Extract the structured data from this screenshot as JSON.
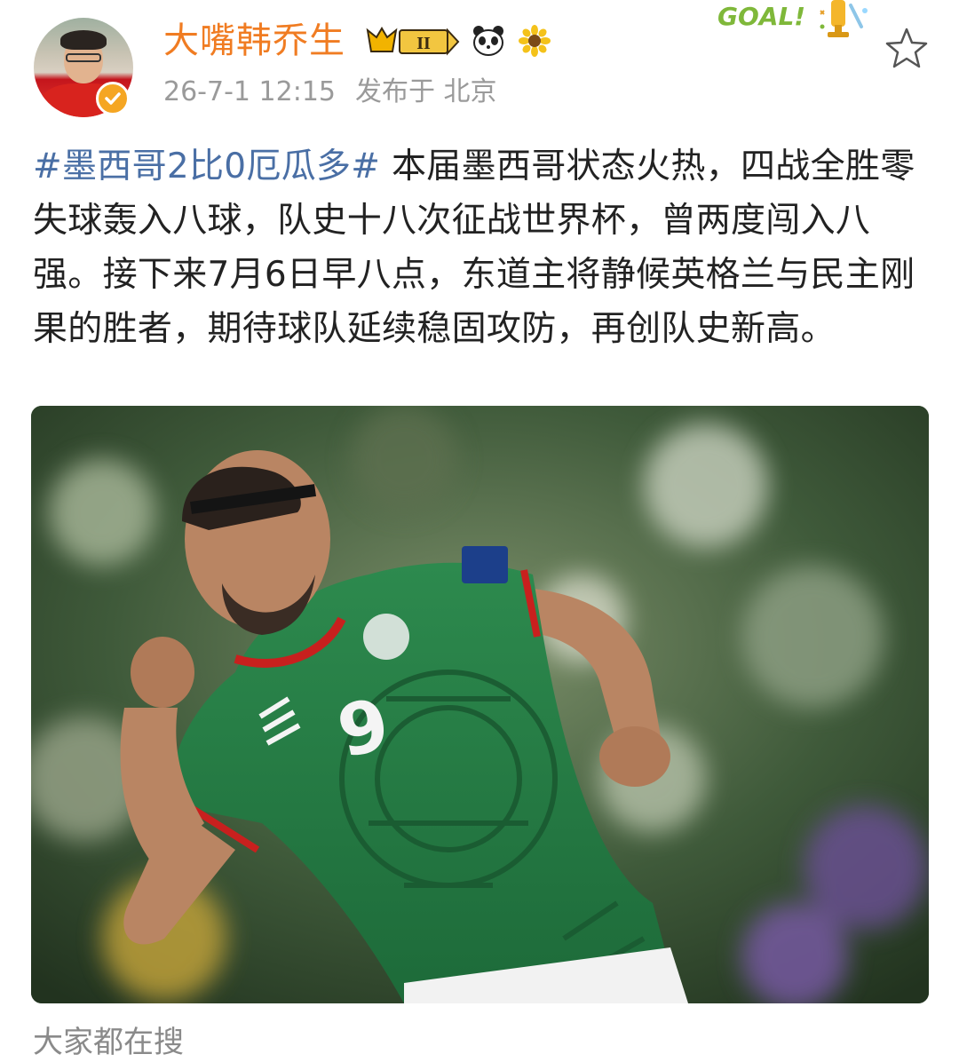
{
  "post": {
    "author": {
      "name": "大嘴韩乔生",
      "level_badge": "II",
      "verified": true
    },
    "meta": {
      "date": "26-7-1 12:15",
      "location": "发布于 北京"
    },
    "decoration": {
      "goal_text": "GOAL!"
    },
    "content": {
      "hashtag": "#墨西哥2比0厄瓜多#",
      "text": " 本届墨西哥状态火热，四战全胜零失球轰入八球，队史十八次征战世界杯，曾两度闯入八强。接下来7月6日早八点，东道主将静候英格兰与民主刚果的胜者，期待球队延续稳固攻防，再创队史新高。"
    },
    "image": {
      "jersey_number": "9"
    },
    "footer": {
      "search_label": "大家都在搜"
    }
  },
  "icons": [
    "verified-icon",
    "level-badge-icon",
    "panda-icon",
    "sunflower-icon",
    "goal-trophy-icon",
    "star-icon"
  ],
  "colors": {
    "username": "#f07c22",
    "hashtag": "#4a6fa5",
    "meta": "#9a9a9a",
    "verified": "#f5a623"
  }
}
